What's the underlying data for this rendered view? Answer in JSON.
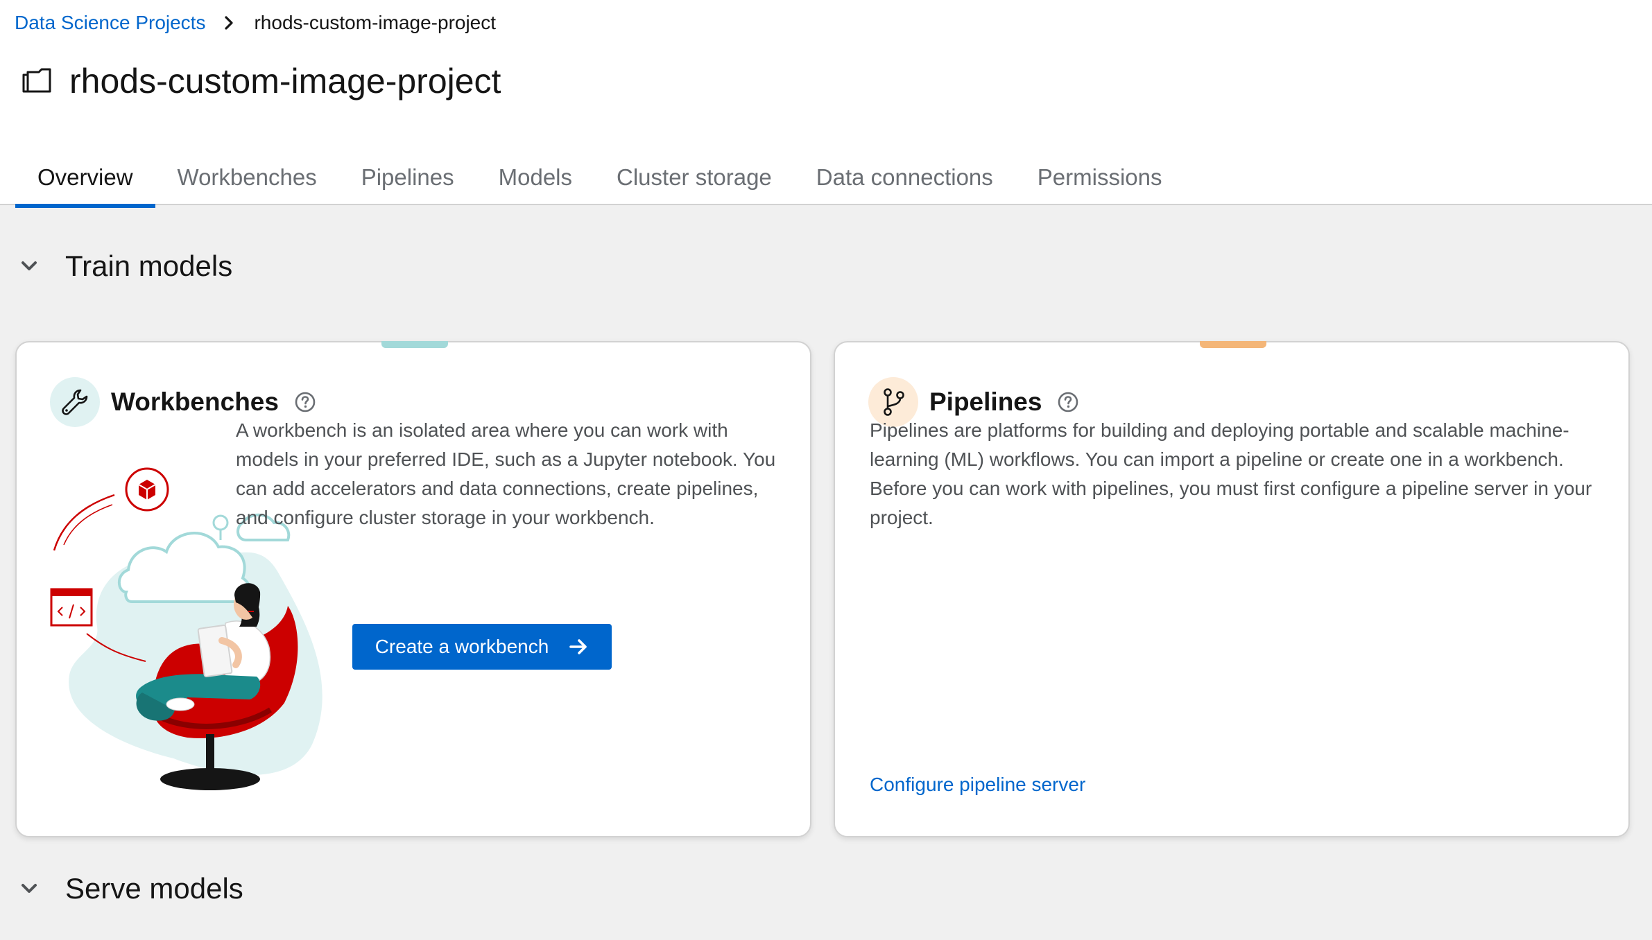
{
  "breadcrumb": {
    "parent": "Data Science Projects",
    "current": "rhods-custom-image-project"
  },
  "header": {
    "title": "rhods-custom-image-project"
  },
  "tabs": [
    {
      "label": "Overview",
      "active": true
    },
    {
      "label": "Workbenches",
      "active": false
    },
    {
      "label": "Pipelines",
      "active": false
    },
    {
      "label": "Models",
      "active": false
    },
    {
      "label": "Cluster storage",
      "active": false
    },
    {
      "label": "Data connections",
      "active": false
    },
    {
      "label": "Permissions",
      "active": false
    }
  ],
  "sections": {
    "train": {
      "title": "Train models",
      "expanded": true
    },
    "serve": {
      "title": "Serve models",
      "expanded": true
    }
  },
  "workbenches_card": {
    "title": "Workbenches",
    "icon": "wrench-icon",
    "accent_color": "#a2d9d9",
    "description": "A workbench is an isolated area where you can work with models in your preferred IDE, such as a Jupyter notebook. You can add accelerators and data connections, create pipelines, and configure cluster storage in your workbench.",
    "action_label": "Create a workbench"
  },
  "pipelines_card": {
    "title": "Pipelines",
    "icon": "code-branch-icon",
    "accent_color": "#f4b678",
    "description": "Pipelines are platforms for building and deploying portable and scalable machine-learning (ML) workflows. You can import a pipeline or create one in a workbench. Before you can work with pipelines, you must first configure a pipeline server in your project.",
    "action_label": "Configure pipeline server"
  },
  "colors": {
    "primary": "#0066cc",
    "link": "#0066cc",
    "background": "#f0f0f0"
  }
}
